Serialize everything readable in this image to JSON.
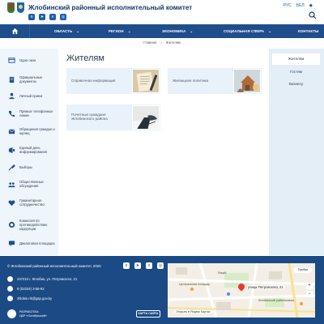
{
  "header": {
    "title": "Жлобинский районный исполнительный комитет",
    "languages": [
      "РУС",
      "БЕЛ"
    ],
    "social_icons": [
      "odnoklassniki-icon",
      "telegram-icon",
      "vk-icon",
      "instagram-icon"
    ]
  },
  "nav": {
    "items": [
      "ОБЛАСТЬ",
      "РЕГИОН",
      "ЭКОНОМИКА",
      "СОЦИАЛЬНАЯ СФЕРА",
      "КОНТАКТЫ"
    ]
  },
  "breadcrumb": {
    "home": "Главная",
    "separator": "›",
    "current": "Жителям"
  },
  "sidebar": {
    "items": [
      {
        "label": "Одно окно",
        "icon": "window-icon"
      },
      {
        "label": "Официальные документы",
        "icon": "document-icon"
      },
      {
        "label": "Личный прием",
        "icon": "person-icon"
      },
      {
        "label": "Прямые телефонные линии",
        "icon": "phone-icon"
      },
      {
        "label": "Обращения граждан и юрлиц",
        "icon": "mail-icon"
      },
      {
        "label": "Единый день информирования",
        "icon": "info-icon"
      },
      {
        "label": "Выборы",
        "icon": "ballot-icon"
      },
      {
        "label": "Общественные обсуждения",
        "icon": "discussion-icon"
      },
      {
        "label": "Гуманитарное сотрудничество",
        "icon": "heart-icon"
      },
      {
        "label": "Комиссия по противодействию коррупции",
        "icon": "shield-icon"
      },
      {
        "label": "Диалоговая площадка",
        "icon": "dialog-icon"
      }
    ]
  },
  "main": {
    "title": "Жителям",
    "cards": [
      {
        "label": "Справочная информация"
      },
      {
        "label": "Жилищная политика"
      },
      {
        "label": "Почетные граждане Жлобинского района"
      }
    ]
  },
  "right_sidebar": {
    "items": [
      "Жителям",
      "Гостям",
      "Бизнесу"
    ],
    "active_index": 0
  },
  "footer": {
    "copyright": "© Жлобинский районный исполнительный комитет, 2025",
    "address": "247210 г. Жлобин, ул. Петровского, 21",
    "phone": "8 (02334) 3-58-92",
    "email": "zhlobin.rik@gsp.gov.by",
    "developer_caption": "РАЗРАБОТКА:",
    "developer_name": "ЦБР «Октябрьский»",
    "sitemap_label": "КАРТА САЙТА"
  },
  "map": {
    "address_label": "улица Петровского, 21",
    "route_label": "Пробки",
    "open_label": "Открыть в Яндекс Картах",
    "zoom_in": "+",
    "zoom_out": "−",
    "places": [
      "Центральная площадь",
      "Жлобинский райисполком",
      "Лицей"
    ]
  },
  "colors": {
    "primary": "#1f4e8c",
    "footer": "#1b4a84",
    "title": "#123a6b",
    "card_bg": "#e9f2fa",
    "sidebar_bg": "#eef5fb",
    "right_sidebar_bg": "#e4eef7"
  }
}
